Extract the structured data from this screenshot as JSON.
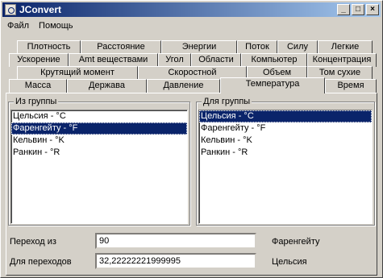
{
  "window": {
    "title": "JConvert"
  },
  "menu": {
    "file": "Файл",
    "help": "Помощь"
  },
  "tabs": {
    "row1": [
      "Плотность",
      "Расстояние",
      "Энергии",
      "Поток",
      "Силу",
      "Легкие"
    ],
    "row2": [
      "Ускорение",
      "Amt веществами",
      "Угол",
      "Области",
      "Компьютер",
      "Концентрация"
    ],
    "row3": [
      "Крутящий момент",
      "Скоростной",
      "Объем",
      "Том сухие"
    ],
    "row4": [
      "Масса",
      "Держава",
      "Давление",
      "Температура",
      "Время"
    ],
    "active": "Температура"
  },
  "from_group": {
    "title": "Из группы",
    "items": [
      "Цельсия - °C",
      "Фаренгейту - °F",
      "Кельвин - °K",
      "Ранкин - °R"
    ],
    "selected_index": 1
  },
  "to_group": {
    "title": "Для группы",
    "items": [
      "Цельсия - °C",
      "Фаренгейту - °F",
      "Кельвин - °K",
      "Ранкин - °R"
    ],
    "selected_index": 0
  },
  "conversion": {
    "from_label": "Переход из",
    "from_value": "90",
    "from_unit": "Фаренгейту",
    "to_label": "Для переходов",
    "to_value": "32,22222221999995",
    "to_unit": "Цельсия"
  }
}
